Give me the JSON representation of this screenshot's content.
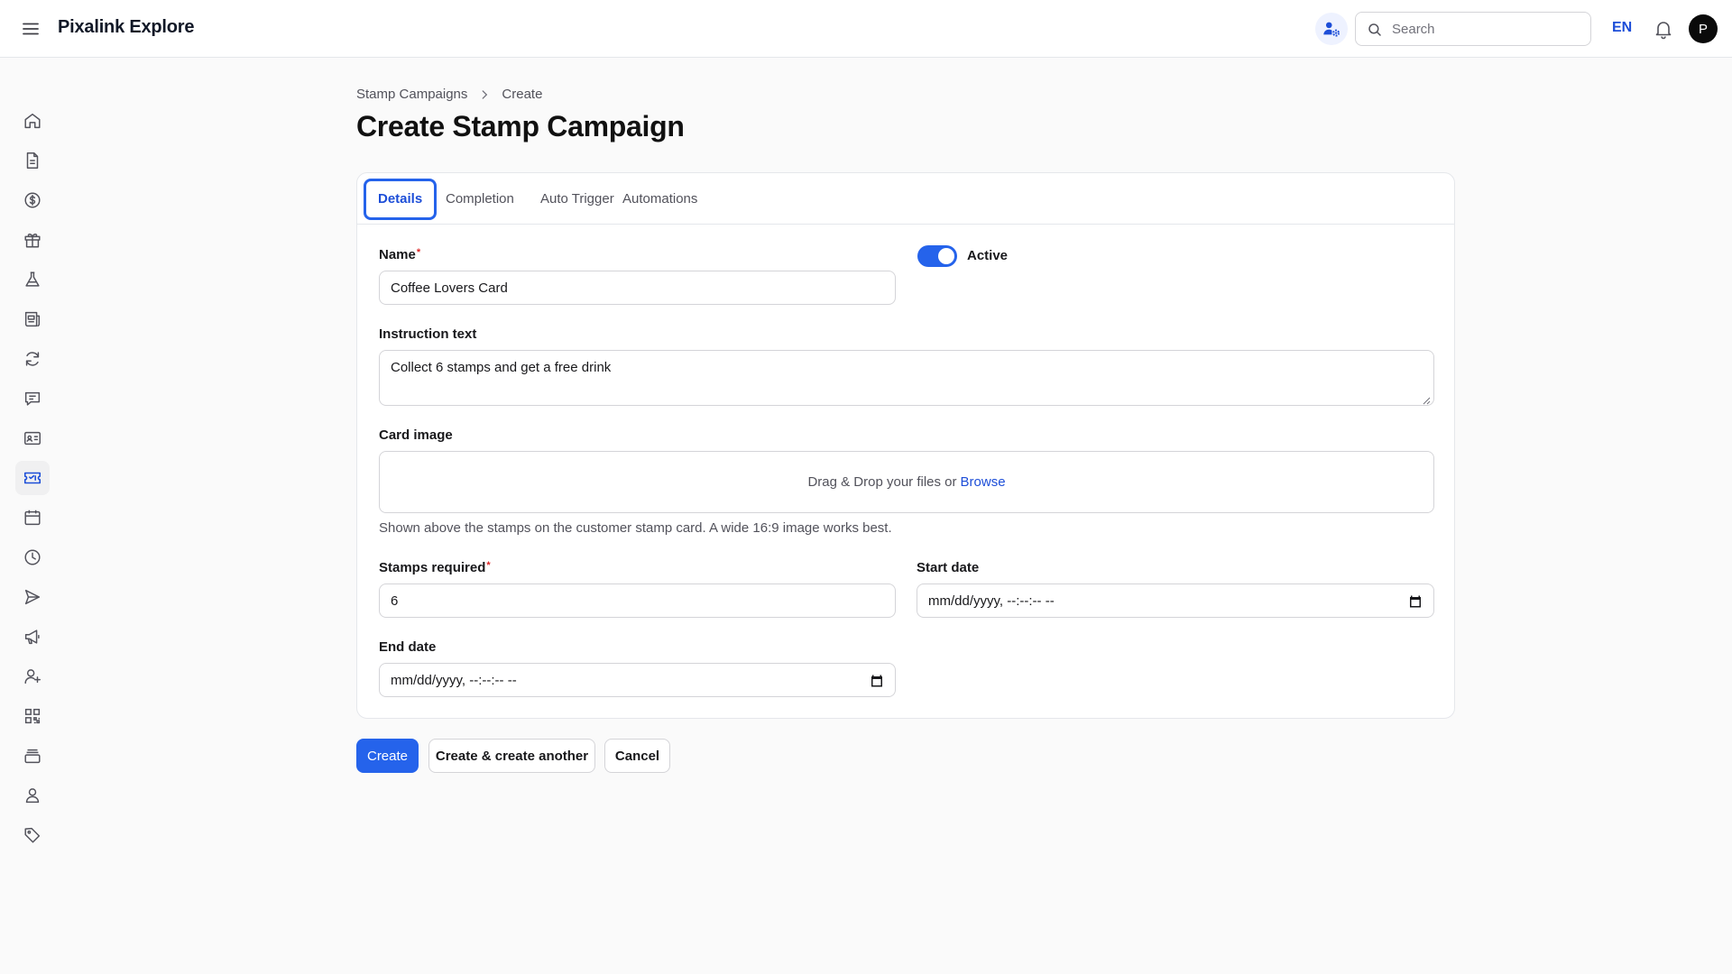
{
  "header": {
    "app_title": "Pixalink Explore",
    "search_placeholder": "Search",
    "language": "EN",
    "avatar_initial": "P"
  },
  "sidebar": {
    "items": [
      {
        "icon": "home-icon"
      },
      {
        "icon": "document-icon"
      },
      {
        "icon": "dollar-icon"
      },
      {
        "icon": "gift-icon"
      },
      {
        "icon": "flask-icon"
      },
      {
        "icon": "newspaper-icon"
      },
      {
        "icon": "refresh-icon"
      },
      {
        "icon": "chat-icon"
      },
      {
        "icon": "id-card-icon"
      },
      {
        "icon": "ticket-icon",
        "active": true
      },
      {
        "icon": "calendar-icon"
      },
      {
        "icon": "clock-icon"
      },
      {
        "icon": "send-icon"
      },
      {
        "icon": "megaphone-icon"
      },
      {
        "icon": "user-plus-icon"
      },
      {
        "icon": "qr-code-icon"
      },
      {
        "icon": "archive-icon"
      },
      {
        "icon": "user-icon"
      },
      {
        "icon": "tag-icon"
      }
    ]
  },
  "breadcrumb": {
    "parent": "Stamp Campaigns",
    "current": "Create"
  },
  "page_title": "Create Stamp Campaign",
  "tabs": [
    {
      "label": "Details",
      "active": true
    },
    {
      "label": "Completion"
    },
    {
      "label": "Auto Trigger"
    },
    {
      "label": "Automations"
    }
  ],
  "form": {
    "name": {
      "label": "Name",
      "required_mark": "*",
      "value": "Coffee Lovers Card"
    },
    "active": {
      "label": "Active",
      "checked": true
    },
    "instruction": {
      "label": "Instruction text",
      "value": "Collect 6 stamps and get a free drink"
    },
    "card_image": {
      "label": "Card image",
      "drop_text": "Drag & Drop your files or",
      "browse_label": "Browse",
      "helper": "Shown above the stamps on the customer stamp card. A wide 16:9 image works best."
    },
    "stamps_required": {
      "label": "Stamps required",
      "required_mark": "*",
      "value": "6"
    },
    "start_date": {
      "label": "Start date",
      "placeholder": "mm/dd/yyyy, --:--:-- --"
    },
    "end_date": {
      "label": "End date",
      "placeholder": "mm/dd/yyyy, --:--:-- --"
    }
  },
  "actions": {
    "create": "Create",
    "create_another": "Create & create another",
    "cancel": "Cancel"
  },
  "colors": {
    "accent": "#2563eb",
    "link": "#1d4ed8",
    "required": "#dc2626"
  }
}
